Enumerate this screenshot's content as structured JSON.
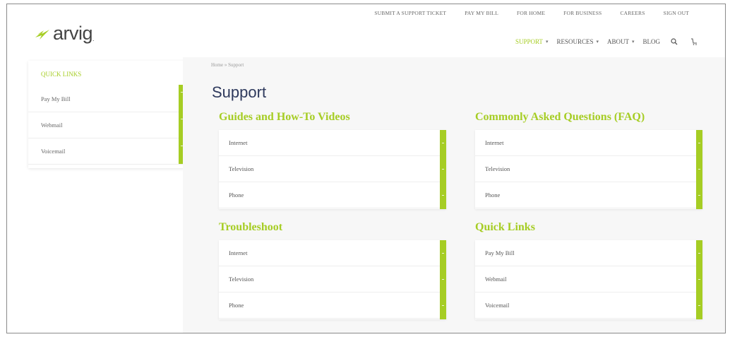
{
  "utility_links": [
    "SUBMIT A SUPPORT TICKET",
    "PAY MY BILL",
    "FOR HOME",
    "FOR BUSINESS",
    "CAREERS",
    "SIGN OUT"
  ],
  "logo": {
    "text": "arvig",
    "trademark": "."
  },
  "main_nav": {
    "items": [
      {
        "label": "SUPPORT",
        "active": true,
        "has_dropdown": true
      },
      {
        "label": "RESOURCES",
        "active": false,
        "has_dropdown": true
      },
      {
        "label": "ABOUT",
        "active": false,
        "has_dropdown": true
      },
      {
        "label": "BLOG",
        "active": false,
        "has_dropdown": false
      }
    ],
    "search_icon": "search-icon",
    "cart_icon": "cart-icon"
  },
  "sidebar": {
    "heading": "QUICK LINKS",
    "items": [
      "Pay My Bill",
      "Webmail",
      "Voicemail"
    ]
  },
  "breadcrumb": {
    "home": "Home",
    "separator": "»",
    "current": "Support"
  },
  "page_title": "Support",
  "sections": [
    {
      "heading": "Guides and How-To Videos",
      "items": [
        "Internet",
        "Television",
        "Phone"
      ]
    },
    {
      "heading": "Commonly Asked Questions (FAQ)",
      "items": [
        "Internet",
        "Television",
        "Phone"
      ]
    },
    {
      "heading": "Troubleshoot",
      "items": [
        "Internet",
        "Television",
        "Phone"
      ]
    },
    {
      "heading": "Quick Links",
      "items": [
        "Pay My Bill",
        "Webmail",
        "Voicemail"
      ]
    }
  ],
  "colors": {
    "accent": "#a6cd24",
    "title": "#2f3a5d",
    "background": "#f7f7f7"
  }
}
